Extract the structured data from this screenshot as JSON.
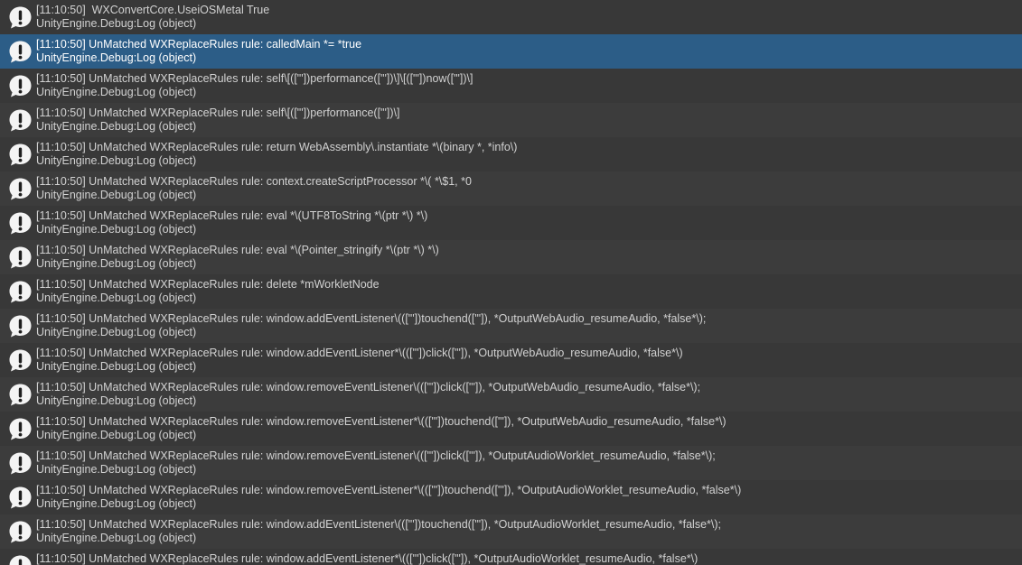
{
  "console": {
    "entries": [
      {
        "message": "[11:10:50]  WXConvertCore.UseiOSMetal True",
        "source": "UnityEngine.Debug:Log (object)",
        "selected": false
      },
      {
        "message": "[11:10:50] UnMatched WXReplaceRules rule: calledMain *= *true",
        "source": "UnityEngine.Debug:Log (object)",
        "selected": true
      },
      {
        "message": "[11:10:50] UnMatched WXReplaceRules rule: self\\[([\"'])performance([\"'])\\]\\[([\"'])now([\"'])\\]",
        "source": "UnityEngine.Debug:Log (object)",
        "selected": false
      },
      {
        "message": "[11:10:50] UnMatched WXReplaceRules rule: self\\[([\"'])performance([\"'])\\]",
        "source": "UnityEngine.Debug:Log (object)",
        "selected": false
      },
      {
        "message": "[11:10:50] UnMatched WXReplaceRules rule: return WebAssembly\\.instantiate *\\(binary *, *info\\)",
        "source": "UnityEngine.Debug:Log (object)",
        "selected": false
      },
      {
        "message": "[11:10:50] UnMatched WXReplaceRules rule: context.createScriptProcessor *\\( *\\$1, *0",
        "source": "UnityEngine.Debug:Log (object)",
        "selected": false
      },
      {
        "message": "[11:10:50] UnMatched WXReplaceRules rule: eval *\\(UTF8ToString *\\(ptr *\\) *\\)",
        "source": "UnityEngine.Debug:Log (object)",
        "selected": false
      },
      {
        "message": "[11:10:50] UnMatched WXReplaceRules rule: eval *\\(Pointer_stringify *\\(ptr *\\) *\\)",
        "source": "UnityEngine.Debug:Log (object)",
        "selected": false
      },
      {
        "message": "[11:10:50] UnMatched WXReplaceRules rule: delete *mWorkletNode",
        "source": "UnityEngine.Debug:Log (object)",
        "selected": false
      },
      {
        "message": "[11:10:50] UnMatched WXReplaceRules rule: window.addEventListener\\(([\"'])touchend([\"']), *OutputWebAudio_resumeAudio, *false*\\);",
        "source": "UnityEngine.Debug:Log (object)",
        "selected": false
      },
      {
        "message": "[11:10:50] UnMatched WXReplaceRules rule: window.addEventListener*\\(([\"'])click([\"']), *OutputWebAudio_resumeAudio, *false*\\)",
        "source": "UnityEngine.Debug:Log (object)",
        "selected": false
      },
      {
        "message": "[11:10:50] UnMatched WXReplaceRules rule: window.removeEventListener\\(([\"'])click([\"']), *OutputWebAudio_resumeAudio, *false*\\);",
        "source": "UnityEngine.Debug:Log (object)",
        "selected": false
      },
      {
        "message": "[11:10:50] UnMatched WXReplaceRules rule: window.removeEventListener*\\(([\"'])touchend([\"']), *OutputWebAudio_resumeAudio, *false*\\)",
        "source": "UnityEngine.Debug:Log (object)",
        "selected": false
      },
      {
        "message": "[11:10:50] UnMatched WXReplaceRules rule: window.removeEventListener\\(([\"'])click([\"']), *OutputAudioWorklet_resumeAudio, *false*\\);",
        "source": "UnityEngine.Debug:Log (object)",
        "selected": false
      },
      {
        "message": "[11:10:50] UnMatched WXReplaceRules rule: window.removeEventListener*\\(([\"'])touchend([\"']), *OutputAudioWorklet_resumeAudio, *false*\\)",
        "source": "UnityEngine.Debug:Log (object)",
        "selected": false
      },
      {
        "message": "[11:10:50] UnMatched WXReplaceRules rule: window.addEventListener\\(([\"'])touchend([\"']), *OutputAudioWorklet_resumeAudio, *false*\\);",
        "source": "UnityEngine.Debug:Log (object)",
        "selected": false
      },
      {
        "message": "[11:10:50] UnMatched WXReplaceRules rule: window.addEventListener*\\(([\"'])click([\"']), *OutputAudioWorklet_resumeAudio, *false*\\)",
        "source": "",
        "selected": false
      }
    ],
    "icon": "info-message-icon",
    "colors": {
      "background": "#383838",
      "row_alt": "#3c3c3c",
      "selected": "#2c5d87",
      "text": "#d2d2d2",
      "icon_fill": "#f4f4f4"
    }
  }
}
